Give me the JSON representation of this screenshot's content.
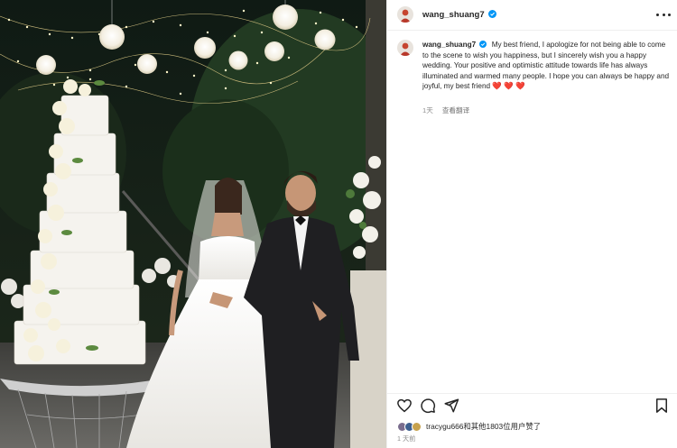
{
  "photo": {
    "alt": "wedding-photo"
  },
  "header": {
    "username": "wang_shuang7",
    "verified_icon": "verified-badge-icon",
    "more_icon": "more-options-icon"
  },
  "caption": {
    "username": "wang_shuang7",
    "text": "My best friend, I apologize for not being able to come to the scene to wish you happiness, but I sincerely wish you a happy wedding. Your positive and optimistic attitude towards life has always illuminated and warmed many people. I hope you can always be happy and joyful, my best friend",
    "hearts": "❤️ ❤️ ❤️",
    "age": "1天",
    "translate": "查看翻译"
  },
  "actions": {
    "like_icon": "heart-icon",
    "comment_icon": "comment-icon",
    "share_icon": "share-icon",
    "save_icon": "bookmark-icon"
  },
  "likes": {
    "text": "tracygu666和其他1803位用户赞了"
  },
  "timestamp": "1 天前",
  "colors": {
    "verified": "#0095f6",
    "heart": "#ed1c24",
    "secondary_text": "#8e8e8e",
    "border": "#efefef"
  }
}
